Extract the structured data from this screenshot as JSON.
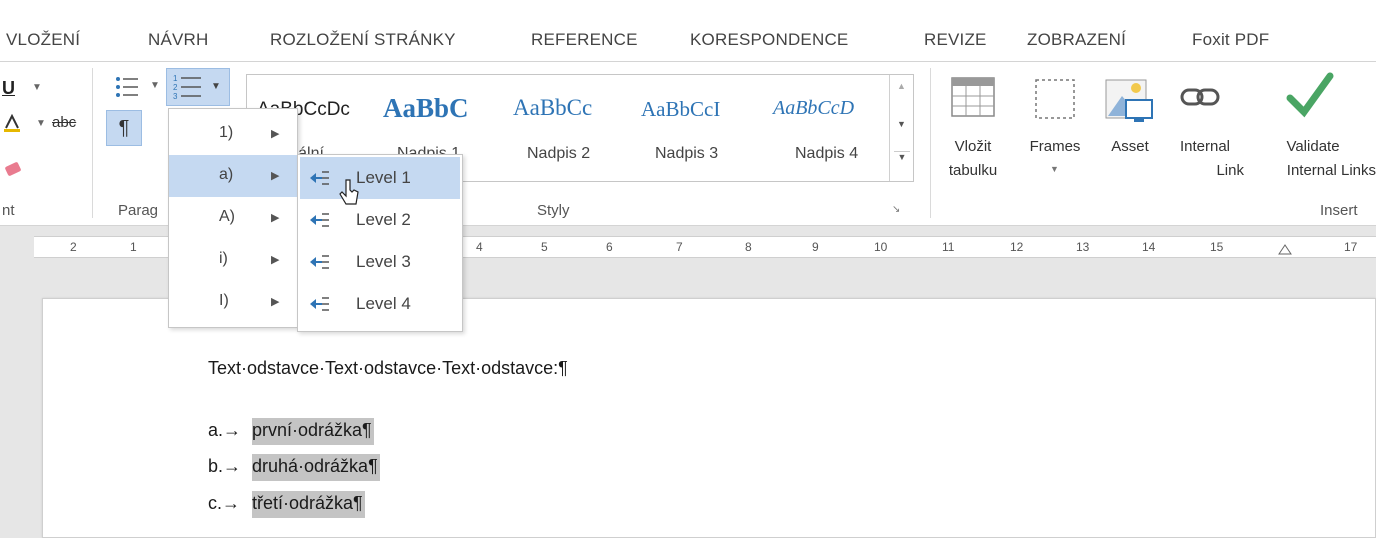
{
  "tabs": [
    "VLOŽENÍ",
    "NÁVRH",
    "ROZLOŽENÍ STRÁNKY",
    "REFERENCE",
    "KORESPONDENCE",
    "REVIZE",
    "ZOBRAZENÍ",
    "Foxit PDF"
  ],
  "ribbon": {
    "font_group_label": "nt",
    "paragraph_group_label": "Parag",
    "styles_group_label": "Styly",
    "insert_group_label": "Insert",
    "strike_label": "abc",
    "pilcrow": "¶",
    "styles": [
      {
        "preview": "AaBbCcDc",
        "name": "Normální"
      },
      {
        "preview": "AaBbC",
        "name": "Nadpis 1"
      },
      {
        "preview": "AaBbCc",
        "name": "Nadpis 2"
      },
      {
        "preview": "AaBbCcI",
        "name": "Nadpis 3"
      },
      {
        "preview": "AaBbCcD",
        "name": "Nadpis 4"
      }
    ],
    "insert_buttons": {
      "vlozit_tabulku": [
        "Vložit",
        "tabulku"
      ],
      "frames": "Frames",
      "asset": "Asset",
      "internal_link": [
        "Internal",
        "Link"
      ],
      "validate": [
        "Validate",
        "Internal Links"
      ]
    }
  },
  "ruler": [
    "2",
    "1",
    "4",
    "5",
    "6",
    "7",
    "8",
    "9",
    "10",
    "11",
    "12",
    "13",
    "14",
    "15",
    "17"
  ],
  "numbering_menu": {
    "formats": [
      "1)",
      "a)",
      "A)",
      "i)",
      "I)"
    ],
    "active_index": 1,
    "levels": [
      "Level 1",
      "Level 2",
      "Level 3",
      "Level 4"
    ],
    "active_level_index": 0
  },
  "document": {
    "paragraph": "Text·odstavce·Text·odstavce·Text·odstavce:¶",
    "list": [
      {
        "marker": "a.→",
        "text": "první·odrážka¶"
      },
      {
        "marker": "b.→",
        "text": "druhá·odrážka¶"
      },
      {
        "marker": "c.→",
        "text": "třetí·odrážka¶"
      }
    ]
  },
  "colors": {
    "accent": "#2e74b5",
    "highlight": "#c4c4c4",
    "menu_active": "#c5d9f1",
    "check_green": "#4aa564"
  }
}
